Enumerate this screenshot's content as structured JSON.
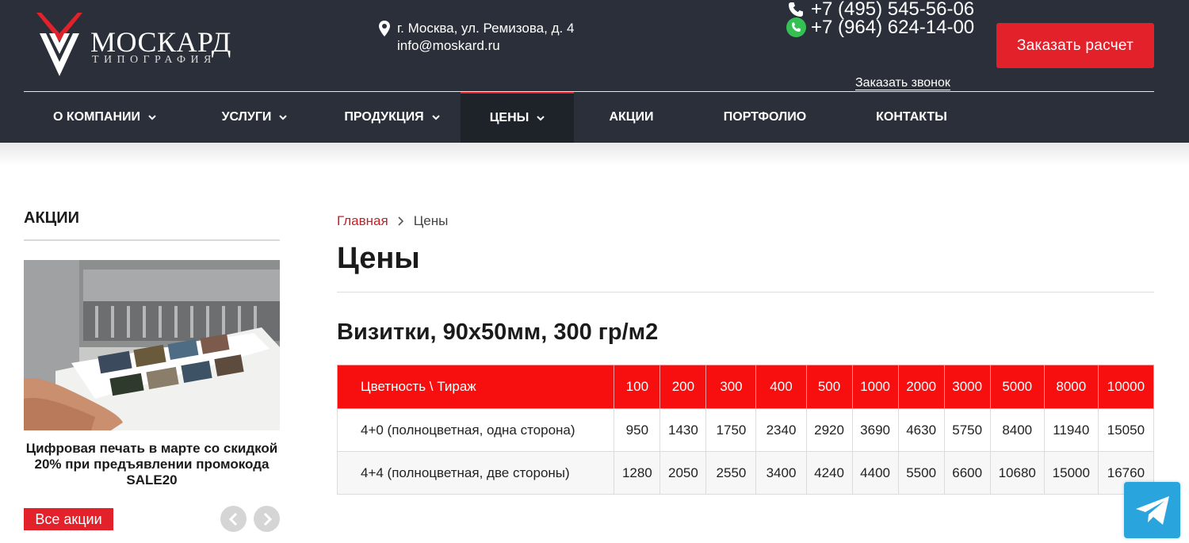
{
  "brand": {
    "name": "МОСКАРД",
    "subtitle": "ТИПОГРАФИЯ"
  },
  "contacts": {
    "address": "г. Москва, ул. Ремизова, д. 4",
    "email": "info@moskard.ru",
    "phone1": "+7 (495) 545-56-06",
    "phone2": "+7 (964) 624-14-00",
    "callback": "Заказать звонок",
    "order_button": "Заказать расчет"
  },
  "nav": {
    "items": [
      {
        "label": "О КОМПАНИИ",
        "has_dropdown": true
      },
      {
        "label": "УСЛУГИ",
        "has_dropdown": true
      },
      {
        "label": "ПРОДУКЦИЯ",
        "has_dropdown": true
      },
      {
        "label": "ЦЕНЫ",
        "has_dropdown": true,
        "active": true
      },
      {
        "label": "АКЦИИ",
        "has_dropdown": false
      },
      {
        "label": "ПОРТФОЛИО",
        "has_dropdown": false
      },
      {
        "label": "КОНТАКТЫ",
        "has_dropdown": false
      }
    ]
  },
  "sidebar": {
    "title": "АКЦИИ",
    "promo_text": "Цифровая печать в марте со скидкой 20% при предъявлении промокода SALE20",
    "all_button": "Все акции"
  },
  "breadcrumb": {
    "home": "Главная",
    "current": "Цены"
  },
  "page": {
    "title": "Цены",
    "section_prefix": "Визитки, 90х50мм,",
    "section_bold": "300 гр/м2"
  },
  "price_table": {
    "header_first": "Цветность \\ Тираж",
    "columns": [
      "100",
      "200",
      "300",
      "400",
      "500",
      "1000",
      "2000",
      "3000",
      "5000",
      "8000",
      "10000"
    ],
    "rows": [
      {
        "label": "4+0 (полноцветная, одна сторона)",
        "values": [
          "950",
          "1430",
          "1750",
          "2340",
          "2920",
          "3690",
          "4630",
          "5750",
          "8400",
          "11940",
          "15050"
        ]
      },
      {
        "label": "4+4 (полноцветная, две стороны)",
        "values": [
          "1280",
          "2050",
          "2550",
          "3400",
          "4240",
          "4400",
          "5500",
          "6600",
          "10680",
          "15000",
          "16760"
        ]
      }
    ]
  },
  "colors": {
    "accent": "#e3212b",
    "header_bg": "#2a2f39",
    "table_header": "#f70f0f",
    "telegram": "#29a4dc"
  }
}
